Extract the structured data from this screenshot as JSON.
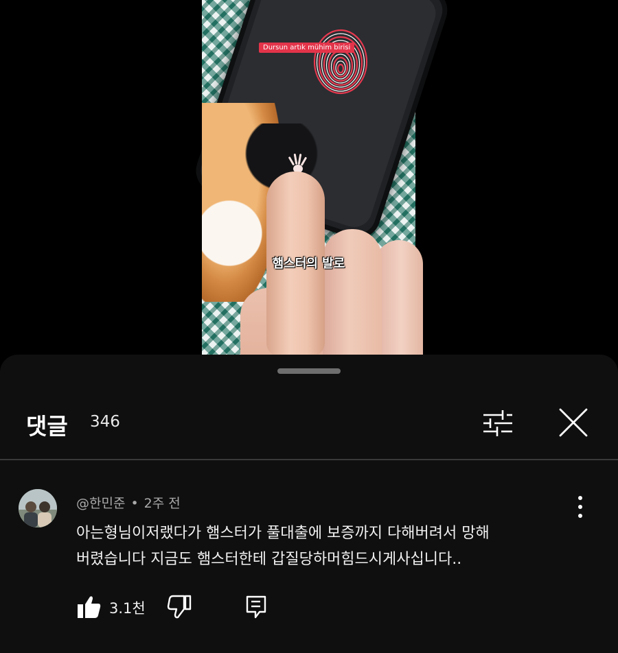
{
  "video": {
    "tag_text": "Dursun artık mühim birisi",
    "caption": "햄스터의 발로"
  },
  "comments_panel": {
    "title": "댓글",
    "count": "346",
    "icons": {
      "filter": "sort-filter-icon",
      "close": "close-icon"
    }
  },
  "comment": {
    "author": "@한민준",
    "separator": "•",
    "time": "2주 전",
    "text_line1": "아는형님이저랬다가 햄스터가 풀대출에 보증까지 다해버려서 망해",
    "text_line2": "버렸습니다 지금도 햄스터한테 갑질당하머힘드시게사십니다..",
    "likes": "3.1천",
    "icons": {
      "more": "more-vertical-icon",
      "like": "thumbs-up-icon",
      "dislike": "thumbs-down-icon",
      "reply": "reply-icon"
    }
  },
  "colors": {
    "sheet_bg": "#0f0f0f",
    "secondary_text": "#aaaaaa",
    "accent_tag": "#e3344a"
  }
}
